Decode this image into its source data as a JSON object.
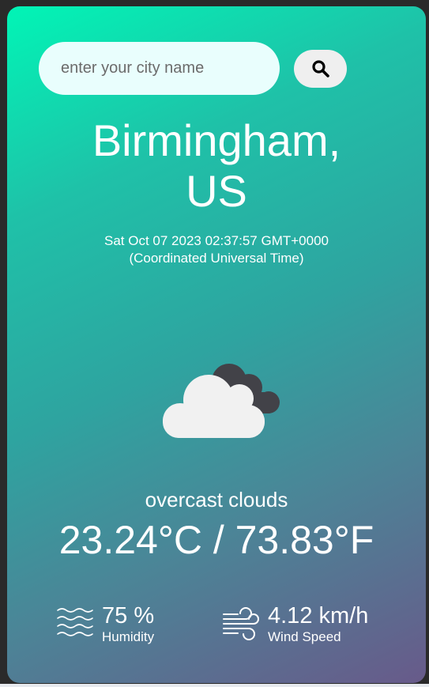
{
  "search": {
    "placeholder": "enter your city name",
    "button_icon": "search-icon"
  },
  "location": {
    "city_line": "Birmingham,",
    "country_line": "US"
  },
  "datetime": {
    "line1": "Sat Oct 07 2023 02:37:57 GMT+0000",
    "line2": "(Coordinated Universal Time)"
  },
  "weather": {
    "icon": "overcast-clouds-icon",
    "description": "overcast clouds",
    "temperature": "23.24°C / 73.83°F"
  },
  "stats": {
    "humidity": {
      "value": "75 %",
      "label": "Humidity",
      "icon": "humidity-waves-icon"
    },
    "wind": {
      "value": "4.12 km/h",
      "label": "Wind Speed",
      "icon": "wind-icon"
    }
  },
  "colors": {
    "gradient_start": "#01f5b6",
    "gradient_end": "#685a8a",
    "input_bg": "#e9fefd",
    "button_bg": "#efefef"
  }
}
